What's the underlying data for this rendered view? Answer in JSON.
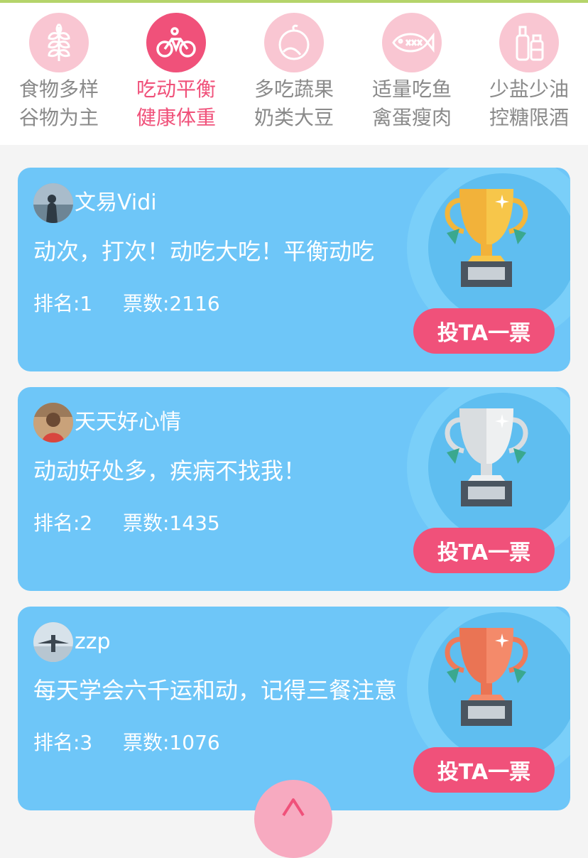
{
  "categories": [
    {
      "line1": "食物多样",
      "line2": "谷物为主",
      "icon": "wheat-icon",
      "active": false
    },
    {
      "line1": "吃动平衡",
      "line2": "健康体重",
      "icon": "bicycle-icon",
      "active": true
    },
    {
      "line1": "多吃蔬果",
      "line2": "奶类大豆",
      "icon": "fruit-icon",
      "active": false
    },
    {
      "line1": "适量吃鱼",
      "line2": "禽蛋瘦肉",
      "icon": "fish-icon",
      "active": false
    },
    {
      "line1": "少盐少油",
      "line2": "控糖限酒",
      "icon": "bottles-icon",
      "active": false
    }
  ],
  "entries": [
    {
      "name": "文易Vidi",
      "message": "动次，打次！动吃大吃！平衡动吃",
      "rank_label": "排名:1",
      "votes_label": "票数:2116",
      "button_label": "投TA一票",
      "trophy": "gold"
    },
    {
      "name": "天天好心情",
      "message": "动动好处多，疾病不找我！",
      "rank_label": "排名:2",
      "votes_label": "票数:1435",
      "button_label": "投TA一票",
      "trophy": "silver"
    },
    {
      "name": "zzp",
      "message": "每天学会六千运和动，记得三餐注意",
      "rank_label": "排名:3",
      "votes_label": "票数:1076",
      "button_label": "投TA一票",
      "trophy": "bronze"
    }
  ],
  "colors": {
    "accent": "#f0517a",
    "card": "#6ec6f8",
    "tab_inactive": "#f9c6d2"
  }
}
